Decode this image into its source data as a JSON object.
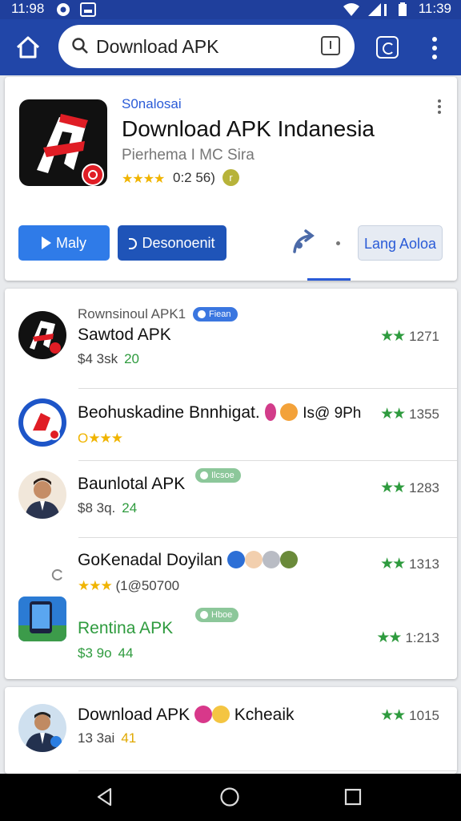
{
  "status": {
    "time_left": "11:98",
    "time_right": "11:39"
  },
  "search": {
    "query": "Download APK"
  },
  "hero": {
    "developer": "S0nalosai",
    "title": "Download APK Indanesia",
    "subtitle": "Pierhema I MC Sira",
    "stars": "★★★★",
    "rating": "0:2 56)",
    "badge": "r",
    "install_label": "Maly",
    "download_label": "Desonoenit",
    "language_label": "Lang Aoloa"
  },
  "list": [
    {
      "category": "Rownsinoul APK1",
      "chip": "Fiean",
      "title": "Sawtod APK",
      "meta": "$4 3sk",
      "meta_num": "20",
      "score": "1271"
    },
    {
      "title": "Beohuskadine Bnnhigat.",
      "extra": "Is@ 9Ph",
      "stars": "★★★",
      "circle": "O",
      "score": "1355"
    },
    {
      "chip": "Ilcsoe",
      "title": "Baunlotal APK",
      "meta": "$8 3q.",
      "meta_num": "24",
      "score": "1283"
    },
    {
      "title": "GoKenadal Doyilan",
      "stars": "★★★",
      "rating_text": "(1@50700",
      "score": "1313"
    },
    {
      "chip": "Hboe",
      "title": "Rentina APK",
      "meta": "$3 9o",
      "meta_num": "44",
      "score": "1:213"
    }
  ],
  "list2": [
    {
      "title": "Download APK",
      "suffix": "Kcheaik",
      "meta": "13 3ai",
      "meta_num": "41",
      "score": "1015"
    }
  ],
  "colors": {
    "primary": "#2146a8",
    "accent_green": "#2e9b3e",
    "accent_blue": "#2a5bd7"
  }
}
